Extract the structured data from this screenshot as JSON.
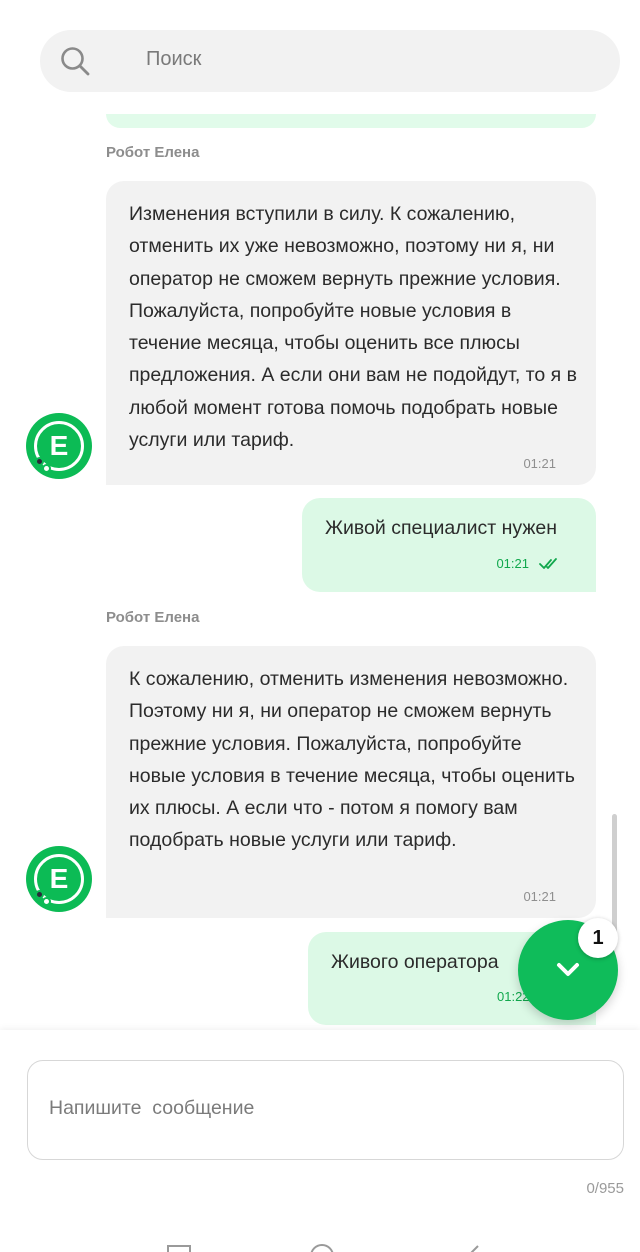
{
  "search": {
    "placeholder": "Поиск",
    "icon": "search-icon"
  },
  "messages": [
    {
      "direction": "incoming",
      "sender": "Робот Елена",
      "text": "Изменения вступили в силу. К сожалению, отменить их уже невозможно, поэтому ни я, ни оператор не сможем вернуть прежние условия. Пожалуйста, попробуйте новые условия в течение месяца, чтобы оценить все плюсы предложения. А если они вам не подойдут, то я в любой момент готова помочь подобрать новые услуги или тариф.",
      "time": "01:21"
    },
    {
      "direction": "outgoing",
      "text": "Живой специалист нужен",
      "time": "01:21",
      "status": "read"
    },
    {
      "direction": "incoming",
      "sender": "Робот Елена",
      "text": "К сожалению, отменить изменения невозможно. Поэтому ни я, ни оператор не сможем вернуть прежние условия. Пожалуйста, попробуйте новые условия в течение месяца, чтобы оценить их плюсы. А если что - потом я помогу вам подобрать новые услуги или тариф.",
      "time": "01:21"
    },
    {
      "direction": "outgoing",
      "text": "Живого оператора",
      "time": "01:22"
    }
  ],
  "avatar": {
    "letter": "Е"
  },
  "scroll_down": {
    "unread_count": "1"
  },
  "composer": {
    "placeholder": "Напишите  сообщение",
    "counter": "0/955"
  },
  "colors": {
    "accent": "#0cbb55",
    "outgoing_bubble": "#dcf9e6",
    "incoming_bubble": "#f2f2f2",
    "outgoing_time": "#11a84d"
  }
}
